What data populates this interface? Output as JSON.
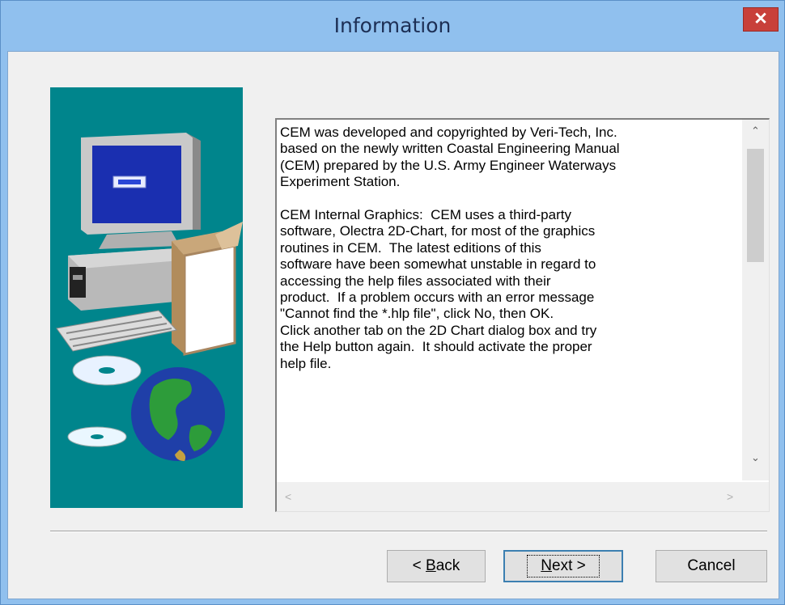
{
  "window": {
    "title": "Information",
    "close_label": "✕"
  },
  "info_text": "CEM was developed and copyrighted by Veri-Tech, Inc.\nbased on the newly written Coastal Engineering Manual\n(CEM) prepared by the U.S. Army Engineer Waterways\nExperiment Station.\n\nCEM Internal Graphics:  CEM uses a third-party\nsoftware, Olectra 2D-Chart, for most of the graphics\nroutines in CEM.  The latest editions of this\nsoftware have been somewhat unstable in regard to\naccessing the help files associated with their\nproduct.  If a problem occurs with an error message\n\"Cannot find the *.hlp file\", click No, then OK.\nClick another tab on the 2D Chart dialog box and try\nthe Help button again.  It should activate the proper\nhelp file.",
  "scroll": {
    "up": "⌃",
    "down": "⌄",
    "left": "<",
    "right": ">"
  },
  "buttons": {
    "back_prefix": "< ",
    "back_key": "B",
    "back_rest": "ack",
    "next_key": "N",
    "next_rest": "ext >",
    "cancel": "Cancel"
  },
  "colors": {
    "titlebar": "#90c0ee",
    "panel": "#00858c",
    "close": "#c8403a"
  }
}
